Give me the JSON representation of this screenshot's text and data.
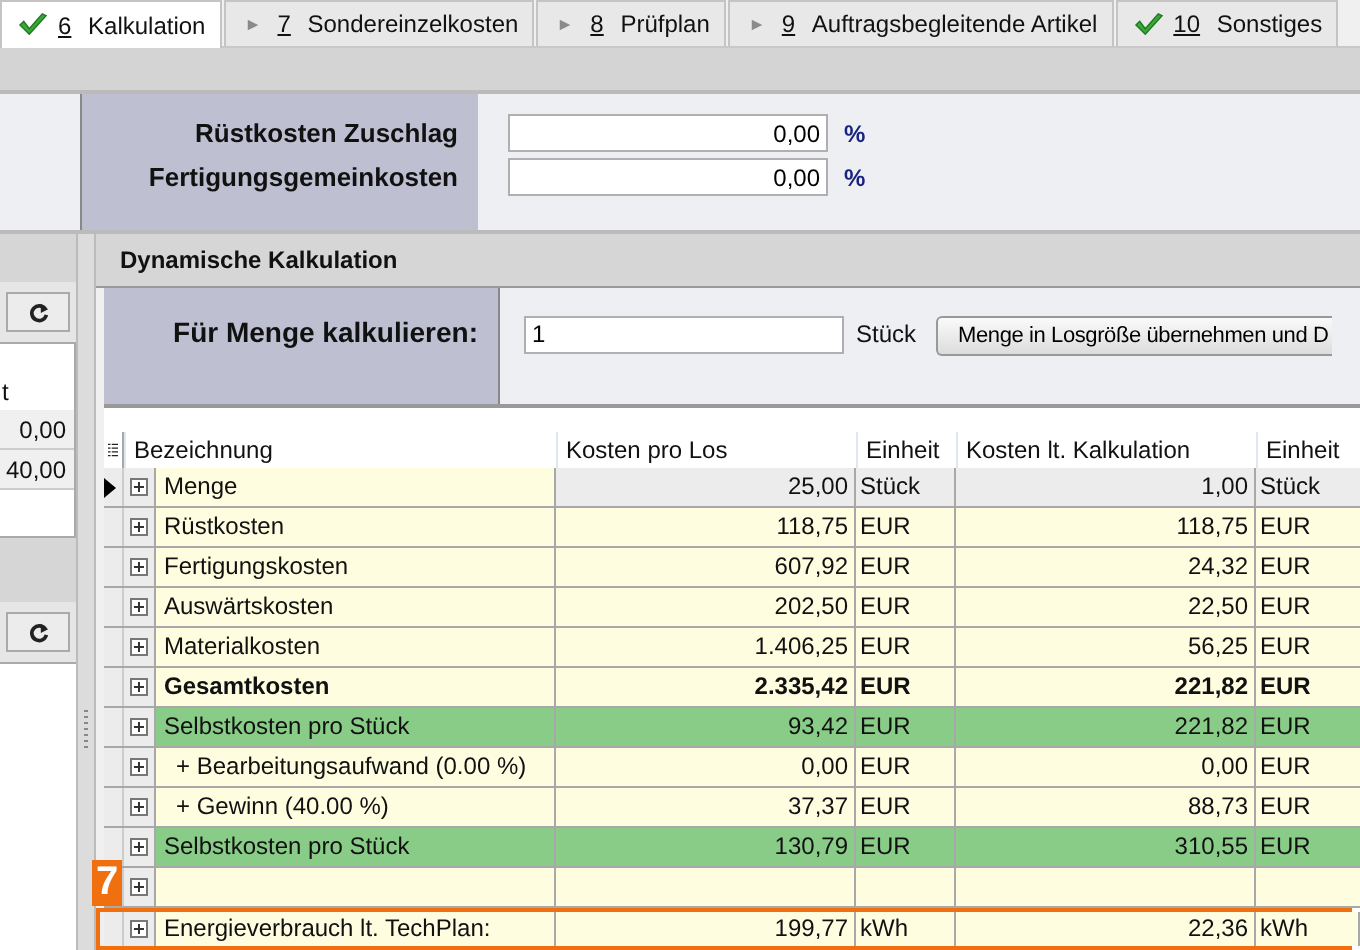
{
  "tabs": [
    {
      "key": "6",
      "label": "Kalkulation",
      "selected": true,
      "done": true
    },
    {
      "key": "7",
      "label": "Sondereinzelkosten",
      "selected": false,
      "done": false
    },
    {
      "key": "8",
      "label": "Prüfplan",
      "selected": false,
      "done": false
    },
    {
      "key": "9",
      "label": "Auftragsbegleitende Artikel",
      "selected": false,
      "done": false
    },
    {
      "key": "10",
      "label": "Sonstiges",
      "selected": false,
      "done": true
    }
  ],
  "surcharges": [
    {
      "label": "Rüstkosten Zuschlag",
      "value": "0,00",
      "unit": "%"
    },
    {
      "label": "Fertigungsgemeinkosten",
      "value": "0,00",
      "unit": "%"
    }
  ],
  "left_panel": {
    "column_header": "t",
    "values": [
      "0,00",
      "40,00"
    ]
  },
  "dynamic": {
    "title": "Dynamische Kalkulation",
    "quantity_label": "Für Menge kalkulieren:",
    "quantity": "1",
    "quantity_unit": "Stück",
    "apply_button": "Menge in Losgröße übernehmen und D"
  },
  "table": {
    "columns": [
      "Bezeichnung",
      "Kosten pro Los",
      "Einheit",
      "Kosten lt. Kalkulation",
      "Einheit"
    ],
    "rows": [
      {
        "kind": "normal",
        "current": true,
        "marked": false,
        "name": "Menge",
        "cost_per_lot": "25,00",
        "unit_1": "Stück",
        "cost_calc": "1,00",
        "unit_2": "Stück"
      },
      {
        "kind": "normal",
        "current": false,
        "marked": false,
        "name": "Rüstkosten",
        "cost_per_lot": "118,75",
        "unit_1": "EUR",
        "cost_calc": "118,75",
        "unit_2": "EUR"
      },
      {
        "kind": "normal",
        "current": false,
        "marked": false,
        "name": "Fertigungskosten",
        "cost_per_lot": "607,92",
        "unit_1": "EUR",
        "cost_calc": "24,32",
        "unit_2": "EUR"
      },
      {
        "kind": "normal",
        "current": false,
        "marked": false,
        "name": "Auswärtskosten",
        "cost_per_lot": "202,50",
        "unit_1": "EUR",
        "cost_calc": "22,50",
        "unit_2": "EUR"
      },
      {
        "kind": "normal",
        "current": false,
        "marked": false,
        "name": "Materialkosten",
        "cost_per_lot": "1.406,25",
        "unit_1": "EUR",
        "cost_calc": "56,25",
        "unit_2": "EUR"
      },
      {
        "kind": "total",
        "current": false,
        "marked": false,
        "name": "Gesamtkosten",
        "cost_per_lot": "2.335,42",
        "unit_1": "EUR",
        "cost_calc": "221,82",
        "unit_2": "EUR"
      },
      {
        "kind": "green",
        "current": false,
        "marked": false,
        "name": "Selbstkosten pro Stück",
        "cost_per_lot": "93,42",
        "unit_1": "EUR",
        "cost_calc": "221,82",
        "unit_2": "EUR"
      },
      {
        "kind": "sub",
        "current": false,
        "marked": false,
        "name": "+ Bearbeitungsaufwand (0.00 %)",
        "cost_per_lot": "0,00",
        "unit_1": "EUR",
        "cost_calc": "0,00",
        "unit_2": "EUR"
      },
      {
        "kind": "sub",
        "current": false,
        "marked": false,
        "name": "+ Gewinn (40.00 %)",
        "cost_per_lot": "37,37",
        "unit_1": "EUR",
        "cost_calc": "88,73",
        "unit_2": "EUR"
      },
      {
        "kind": "green",
        "current": false,
        "marked": false,
        "name": "Selbstkosten pro Stück",
        "cost_per_lot": "130,79",
        "unit_1": "EUR",
        "cost_calc": "310,55",
        "unit_2": "EUR"
      },
      {
        "kind": "empty",
        "current": false,
        "marked": false
      },
      {
        "kind": "normal",
        "current": false,
        "marked": true,
        "name": "Energieverbrauch lt. TechPlan:",
        "cost_per_lot": "199,77",
        "unit_1": "kWh",
        "cost_calc": "22,36",
        "unit_2": "kWh"
      }
    ]
  },
  "callout": {
    "number": "7"
  }
}
